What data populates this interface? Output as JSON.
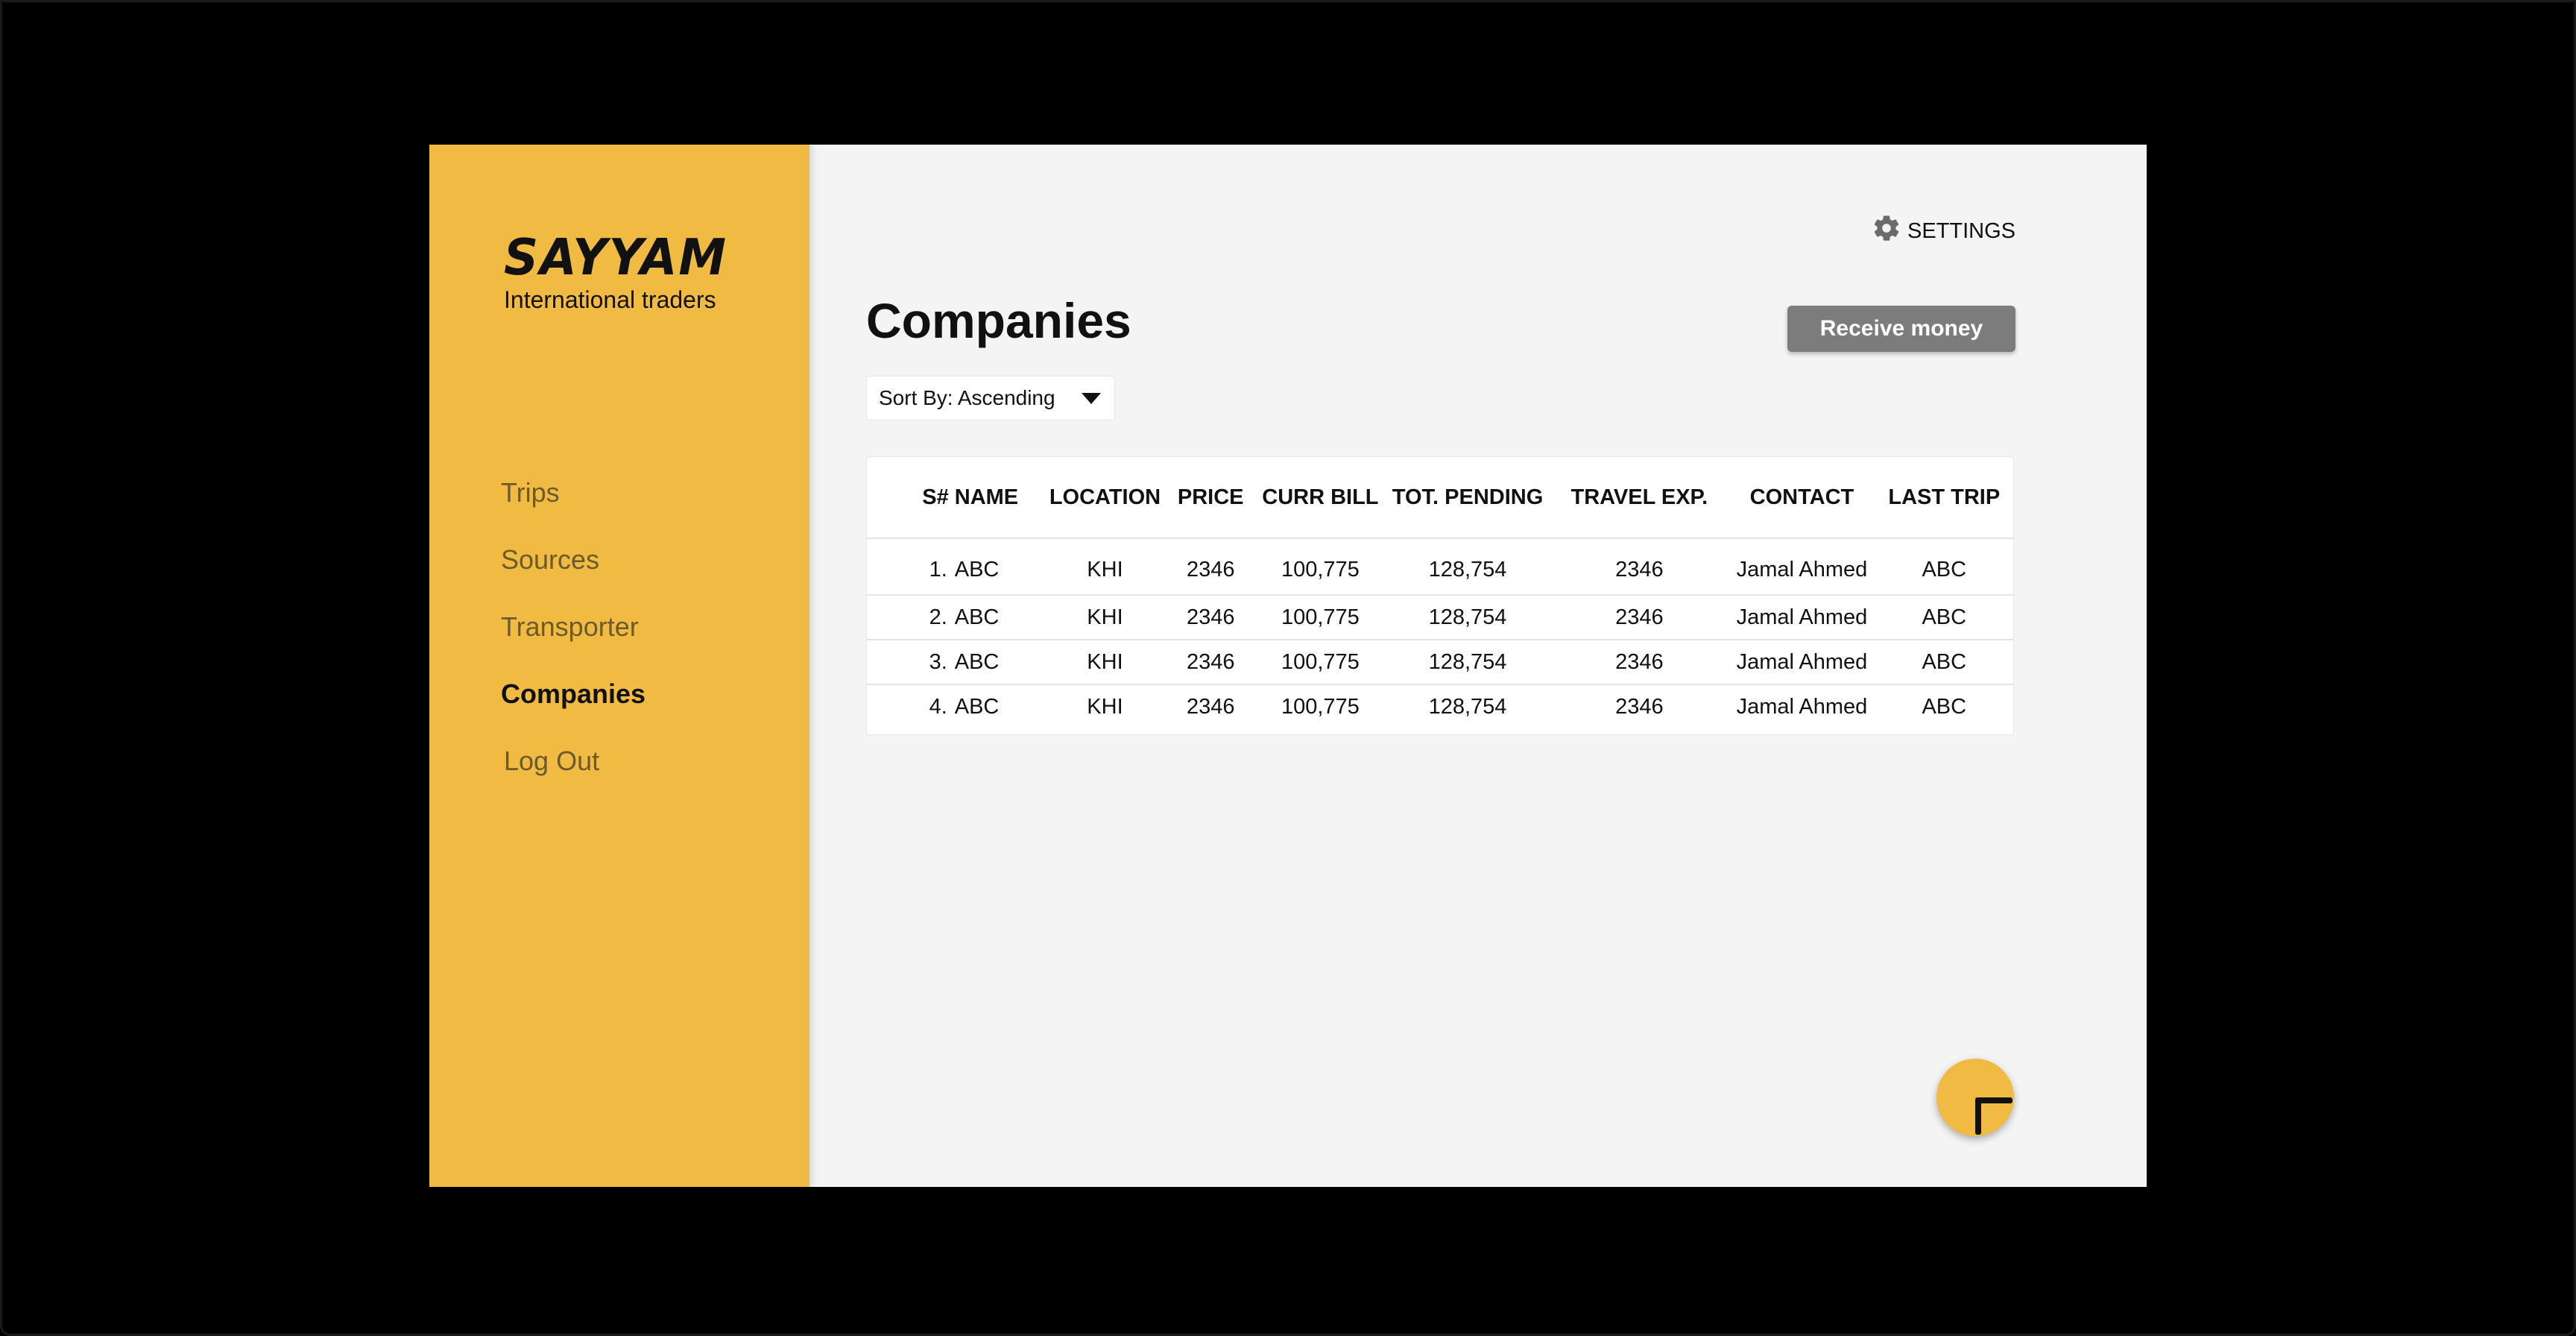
{
  "brand": {
    "title": "SAYYAM",
    "subtitle": "International traders"
  },
  "sidebar": {
    "items": [
      {
        "label": "Trips",
        "active": false
      },
      {
        "label": "Sources",
        "active": false
      },
      {
        "label": "Transporter",
        "active": false
      },
      {
        "label": "Companies",
        "active": true
      },
      {
        "label": "Log Out",
        "active": false
      }
    ]
  },
  "header": {
    "settings_label": "SETTINGS",
    "settings_icon": "gear-icon"
  },
  "main": {
    "title": "Companies",
    "receive_button": "Receive money",
    "sort_label": "Sort By: Ascending"
  },
  "table": {
    "columns": [
      "S#",
      "NAME",
      "LOCATION",
      "PRICE",
      "CURR BILL",
      "TOT. PENDING",
      "TRAVEL EXP.",
      "CONTACT",
      "LAST TRIP"
    ],
    "rows": [
      [
        "1.",
        "ABC",
        "KHI",
        "2346",
        "100,775",
        "128,754",
        "2346",
        "Jamal Ahmed",
        "ABC"
      ],
      [
        "2.",
        "ABC",
        "KHI",
        "2346",
        "100,775",
        "128,754",
        "2346",
        "Jamal Ahmed",
        "ABC"
      ],
      [
        "3.",
        "ABC",
        "KHI",
        "2346",
        "100,775",
        "128,754",
        "2346",
        "Jamal Ahmed",
        "ABC"
      ],
      [
        "4.",
        "ABC",
        "KHI",
        "2346",
        "100,775",
        "128,754",
        "2346",
        "Jamal Ahmed",
        "ABC"
      ]
    ]
  },
  "fab": {
    "icon": "plus-icon"
  },
  "colors": {
    "accent": "#f1bb43",
    "background": "#f4f4f4",
    "button_gray": "#7c7c7c"
  }
}
